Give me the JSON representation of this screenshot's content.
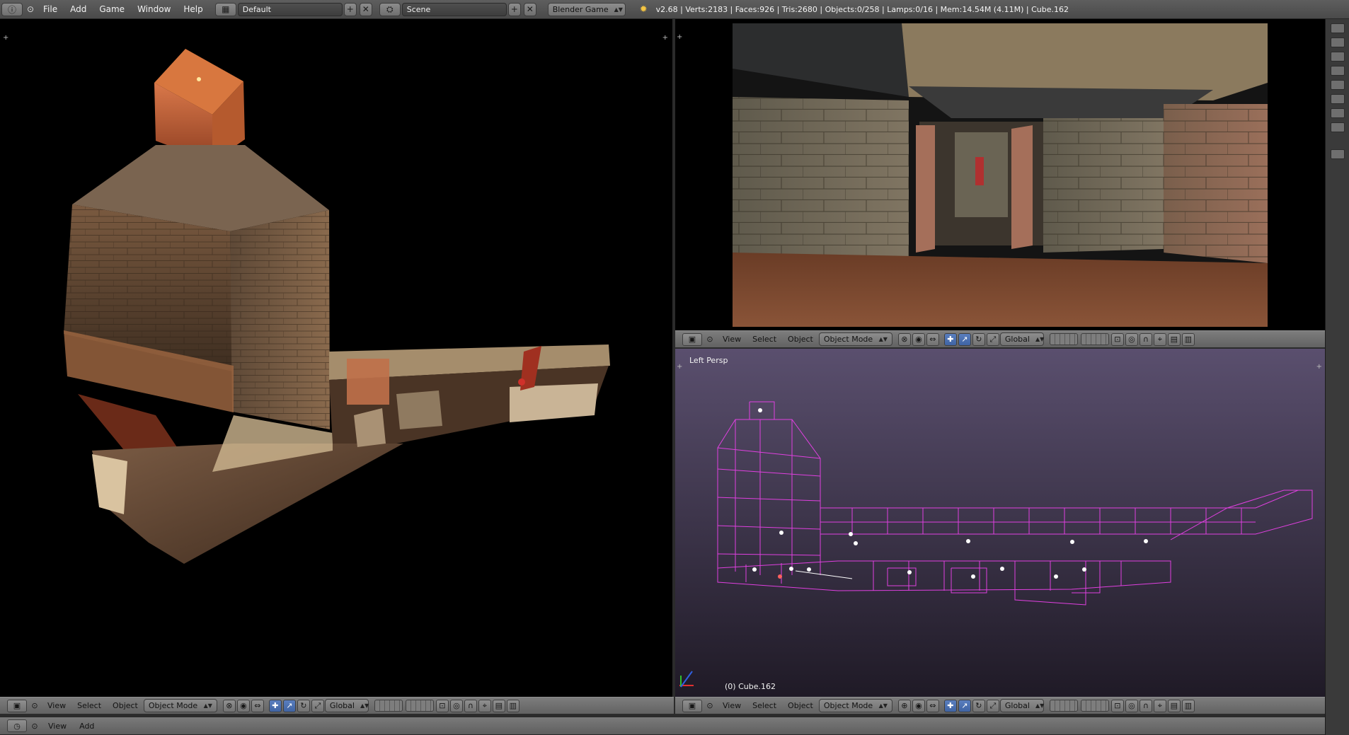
{
  "top_bar": {
    "menus": [
      "File",
      "Add",
      "Game",
      "Window",
      "Help"
    ],
    "layout_name": "Default",
    "scene_name": "Scene",
    "engine": "Blender Game",
    "stats": "v2.68 | Verts:2183 | Faces:926 | Tris:2680 | Objects:0/258 | Lamps:0/16 | Mem:14.54M (4.11M) | Cube.162"
  },
  "viewport_right": {
    "label": "Left Persp",
    "selected_object": "(0) Cube.162"
  },
  "viewport_header": {
    "menus": [
      "View",
      "Select",
      "Object"
    ],
    "mode": "Object Mode",
    "orientation": "Global"
  },
  "bottom_bar": {
    "menus": [
      "View",
      "Add"
    ]
  },
  "colors": {
    "wireframe": "#e040e0",
    "viewport_bg_top": "#5a4f6e",
    "viewport_bg_bottom": "#1f1a26",
    "header_gray": "#6e6e6e",
    "active_blue": "#4a6fb0"
  }
}
